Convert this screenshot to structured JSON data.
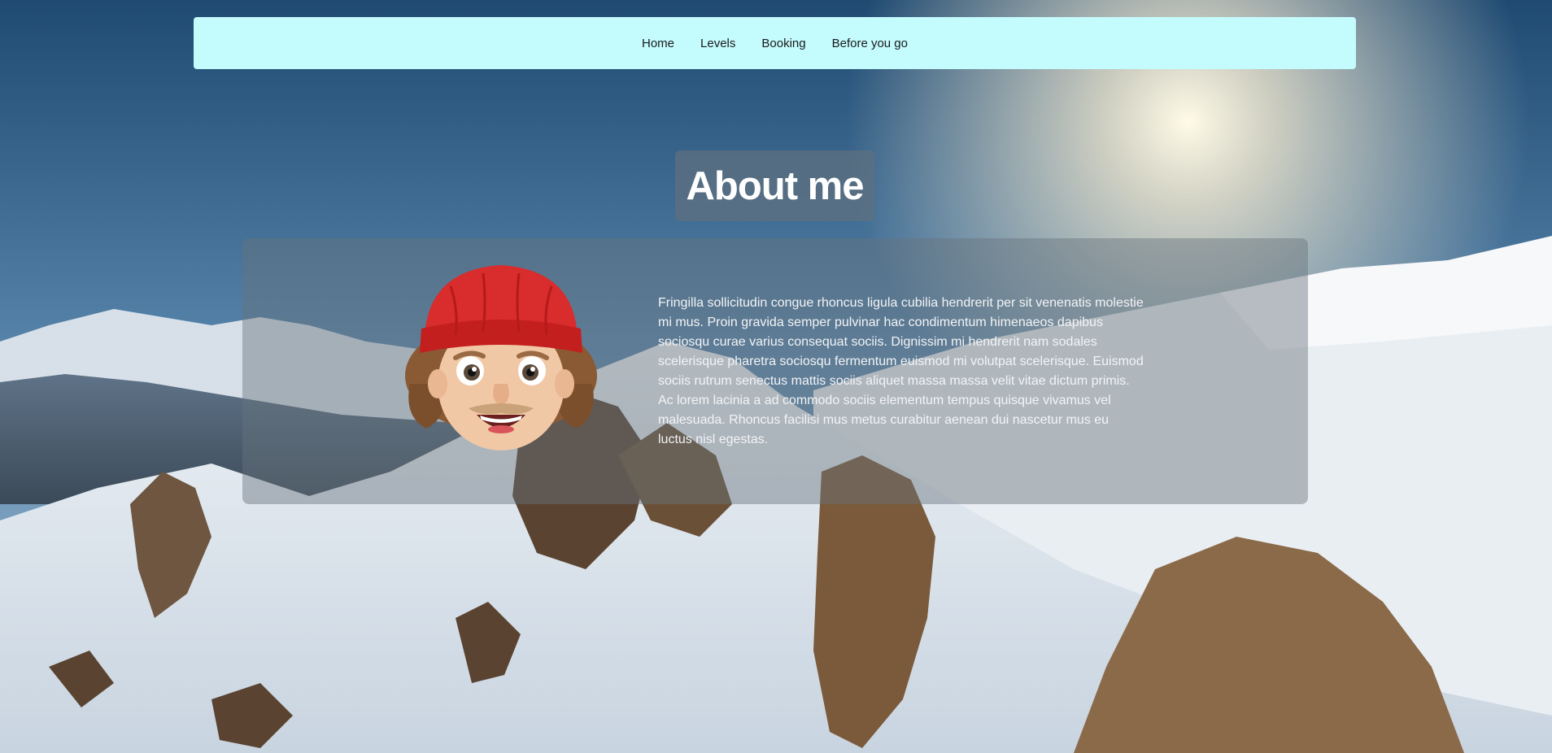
{
  "nav": {
    "items": [
      {
        "label": "Home"
      },
      {
        "label": "Levels"
      },
      {
        "label": "Booking"
      },
      {
        "label": "Before you go"
      }
    ]
  },
  "hero": {
    "title": "About me"
  },
  "about": {
    "avatar_icon": "memoji-avatar-red-beanie",
    "text": "Fringilla sollicitudin congue rhoncus ligula cubilia hendrerit per sit venenatis molestie mi mus. Proin gravida semper pulvinar hac condimentum himenaeos dapibus sociosqu curae varius consequat sociis. Dignissim mi hendrerit nam sodales scelerisque pharetra sociosqu fermentum euismod mi volutpat scelerisque. Euismod sociis rutrum senectus mattis sociis aliquet massa massa velit vitae dictum primis. Ac lorem lacinia a ad commodo sociis elementum tempus quisque vivamus vel malesuada. Rhoncus facilisi mus metus curabitur aenean dui nascetur mus eu luctus nisl egestas."
  },
  "colors": {
    "nav_background": "#c4fbfd",
    "title_box": "#60707e"
  }
}
